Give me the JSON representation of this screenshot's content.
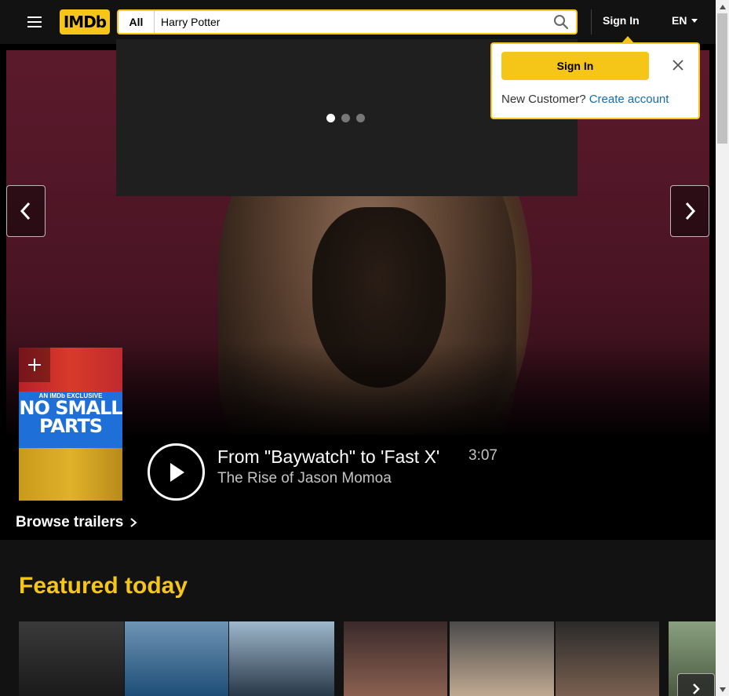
{
  "header": {
    "logo": "IMDb",
    "search_category": "All",
    "search_value": "Harry Potter",
    "sign_in": "Sign In",
    "language": "EN"
  },
  "popup": {
    "sign_in_button": "Sign In",
    "new_customer": "New Customer?",
    "create_account": "Create account"
  },
  "hero": {
    "poster_exclusive": "AN IMDb EXCLUSIVE",
    "poster_title_line1": "NO SMALL",
    "poster_title_line2": "PARTS",
    "trailer_title": "From \"Baywatch\" to 'Fast X'",
    "trailer_subtitle": "The Rise of Jason Momoa",
    "duration": "3:07",
    "browse_trailers": "Browse trailers"
  },
  "featured": {
    "title": "Featured today"
  },
  "colors": {
    "brand": "#f5c518",
    "link": "#136cb2"
  }
}
